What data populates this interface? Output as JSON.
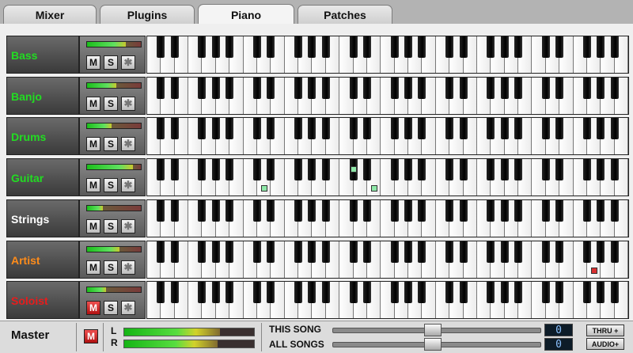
{
  "tabs": [
    {
      "label": "Mixer",
      "active": false
    },
    {
      "label": "Plugins",
      "active": false
    },
    {
      "label": "Piano",
      "active": true
    },
    {
      "label": "Patches",
      "active": false
    }
  ],
  "track_buttons": {
    "mute": "M",
    "solo": "S",
    "settings_icon": "gear-icon"
  },
  "tracks": [
    {
      "name": "Bass",
      "color": "#22dd22",
      "meter": 0.72,
      "mute_on": false
    },
    {
      "name": "Banjo",
      "color": "#22dd22",
      "meter": 0.55,
      "mute_on": false
    },
    {
      "name": "Drums",
      "color": "#22dd22",
      "meter": 0.45,
      "mute_on": false
    },
    {
      "name": "Guitar",
      "color": "#22dd22",
      "meter": 0.85,
      "mute_on": false
    },
    {
      "name": "Strings",
      "color": "#ffffff",
      "meter": 0.3,
      "mute_on": false
    },
    {
      "name": "Artist",
      "color": "#ff8c1a",
      "meter": 0.6,
      "mute_on": false
    },
    {
      "name": "Soloist",
      "color": "#e81c1c",
      "meter": 0.35,
      "mute_on": true
    }
  ],
  "pressed_notes": [
    {
      "track": 3,
      "white_key": 8,
      "color": "#8ee8a8"
    },
    {
      "track": 3,
      "black_key_after_white": 14,
      "color": "#8ee8a8"
    },
    {
      "track": 3,
      "white_key": 16,
      "color": "#8ee8a8"
    },
    {
      "track": 5,
      "white_key": 32,
      "color": "#d83030"
    }
  ],
  "master": {
    "label": "Master",
    "mute": "M",
    "left_label": "L",
    "right_label": "R",
    "left_level": 0.74,
    "right_level": 0.72,
    "this_song_label": "THIS SONG",
    "all_songs_label": "ALL SONGS",
    "this_song_value": "0",
    "all_songs_value": "0",
    "this_song_slider": 0.48,
    "all_songs_slider": 0.48,
    "thru_label": "THRU +",
    "audio_label": "AUDIO+"
  }
}
